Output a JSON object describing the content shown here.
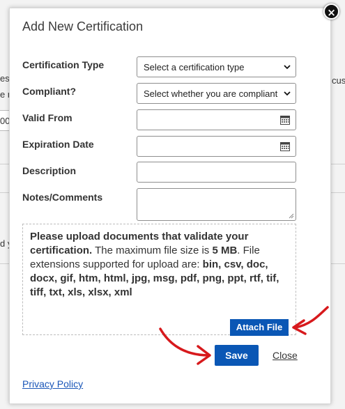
{
  "background": {
    "frag_1": "es p",
    "frag_2": "e n",
    "frag_3": "cus",
    "frag_4": "d y",
    "input_value": "00"
  },
  "modal": {
    "title": "Add New Certification",
    "fields": {
      "certification_type": {
        "label": "Certification Type",
        "value": "Select a certification type"
      },
      "compliant": {
        "label": "Compliant?",
        "value": "Select whether you are compliant ..."
      },
      "valid_from": {
        "label": "Valid From",
        "value": ""
      },
      "expiration_date": {
        "label": "Expiration Date",
        "value": ""
      },
      "description": {
        "label": "Description",
        "value": ""
      },
      "notes": {
        "label": "Notes/Comments",
        "value": ""
      }
    },
    "upload": {
      "bold_text": "Please upload documents that validate your certification.",
      "text_1": " The maximum file size is ",
      "max_size": "5 MB",
      "text_2": ". File extensions supported for upload are: ",
      "extensions": "bin, csv, doc, docx, gif, htm, html, jpg, msg, pdf, png, ppt, rtf, tif, tiff, txt, xls, xlsx, xml",
      "attach_label": "Attach File"
    },
    "save_label": "Save",
    "close_label": "Close",
    "privacy_label": "Privacy Policy",
    "close_icon": "×"
  },
  "colors": {
    "primary_button": "#0a57b5",
    "annotation_arrow": "#d7191c"
  }
}
